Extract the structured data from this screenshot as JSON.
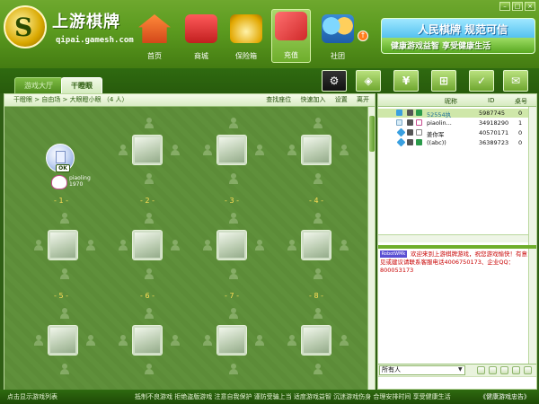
{
  "header": {
    "brand_title": "上游棋牌",
    "brand_url": "qipai.gamesh.com",
    "nav": [
      {
        "label": "首页",
        "icon": "home-icon"
      },
      {
        "label": "商城",
        "icon": "shopping-cart-icon"
      },
      {
        "label": "保险箱",
        "icon": "money-bag-icon"
      },
      {
        "label": "充值",
        "icon": "recharge-card-icon"
      },
      {
        "label": "社团",
        "icon": "club-people-icon"
      }
    ],
    "banner_title": "人民棋牌 规范可信",
    "banner_sub": "健康游戏益智 享受健康生活"
  },
  "tabs": [
    {
      "label": "游戏大厅"
    },
    {
      "label": "干瞪眼"
    }
  ],
  "toolbar_icons": [
    "settings-icon",
    "shield-icon",
    "yuan-icon",
    "gift-icon",
    "checkbox-icon",
    "mail-icon"
  ],
  "room": {
    "breadcrumb": "干瞪眼 > 自由场 > 大眼瞪小眼 （4 人）",
    "actions": [
      "查找座位",
      "快速加入",
      "设置",
      "离开"
    ],
    "tables": [
      {
        "number": "- 1 -"
      },
      {
        "number": "- 2 -"
      },
      {
        "number": "- 3 -"
      },
      {
        "number": "- 4 -"
      },
      {
        "number": "- 5 -"
      },
      {
        "number": "- 6 -"
      },
      {
        "number": "- 7 -"
      },
      {
        "number": "- 8 -"
      }
    ],
    "player": {
      "name": "piaoling",
      "score": "1970",
      "status": "OK"
    }
  },
  "user_list": {
    "columns": [
      "昵称",
      "ID",
      "桌号"
    ],
    "rows": [
      {
        "name": "52554执",
        "id": "5987745",
        "table": "0"
      },
      {
        "name": "piaolin...",
        "id": "34918290",
        "table": "1"
      },
      {
        "name": "姜你军",
        "id": "40570171",
        "table": "0"
      },
      {
        "name": "((abc))",
        "id": "36389723",
        "table": "0"
      }
    ]
  },
  "chat": {
    "logo_text": "RobotWMk",
    "message": "欢迎来到上游棋牌游戏，祝您游戏愉快！有意见或建议请联系客服电话4006750173、企业QQ：800053173",
    "target": "所有人"
  },
  "footer": {
    "left": "点击显示游戏列表",
    "marquee": "抵制不良游戏 拒绝盗版游戏 注意自我保护 谨防受骗上当 适度游戏益智 沉迷游戏伤身 合理安排时间 享受健康生活",
    "right": "《健康游戏忠告》"
  },
  "colors": {
    "header_green": "#5b9a1f",
    "board_green": "#5c8c38",
    "table_number": "#ffde56",
    "chat_red": "#c80000"
  }
}
